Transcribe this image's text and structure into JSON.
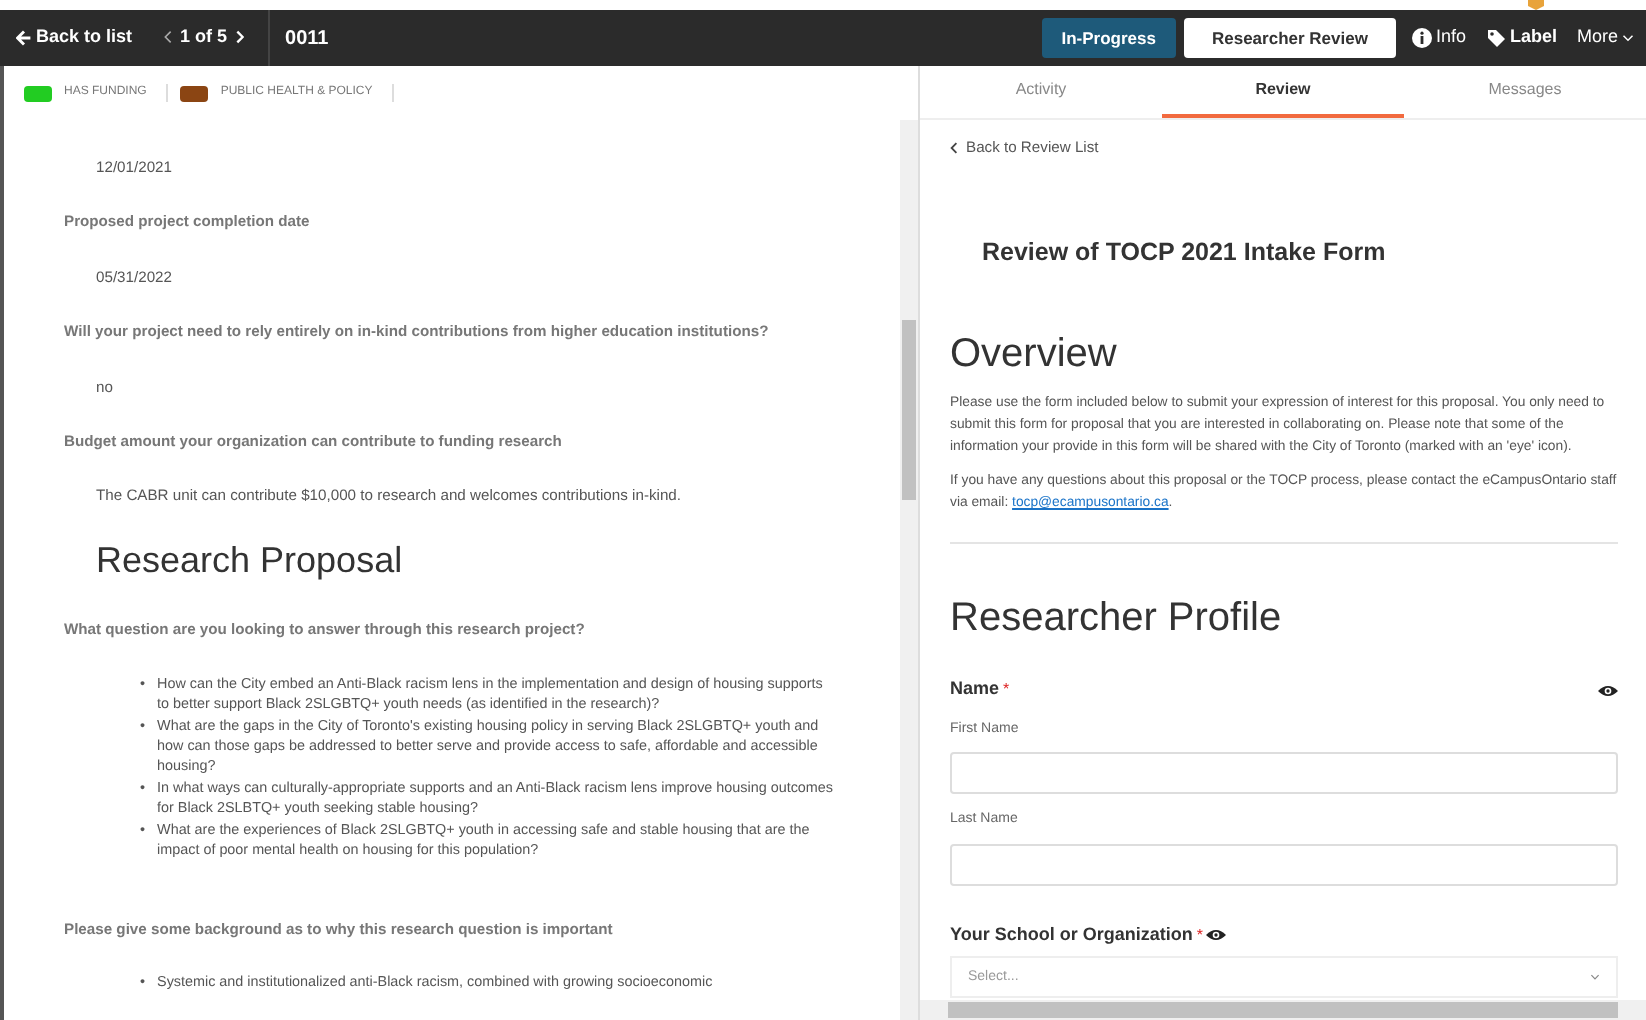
{
  "top_bar": {
    "back": "Back to list",
    "pager": "1 of 5",
    "record_id": "0011",
    "status": "In-Progress",
    "stage": "Researcher Review",
    "actions": [
      {
        "kind": "info",
        "label": "Info"
      },
      {
        "kind": "label",
        "label": "Label"
      },
      {
        "kind": "more",
        "label": "More"
      }
    ]
  },
  "tags": [
    {
      "label": "HAS FUNDING",
      "color": "#22cc22"
    },
    {
      "label": "PUBLIC HEALTH & POLICY",
      "color": "#8b4513"
    }
  ],
  "submission": [
    {
      "kind": "value",
      "text": "12/01/2021"
    },
    {
      "kind": "question",
      "text": "Proposed project completion date"
    },
    {
      "kind": "value",
      "text": "05/31/2022"
    },
    {
      "kind": "question",
      "text": "Will your project need to rely entirely on in-kind contributions from higher education institutions?"
    },
    {
      "kind": "value",
      "text": "no"
    },
    {
      "kind": "question",
      "text": "Budget amount your organization can contribute to funding research"
    },
    {
      "kind": "value",
      "text": "The CABR unit can contribute $10,000 to research and welcomes contributions in-kind."
    },
    {
      "kind": "heading",
      "text": "Research Proposal"
    },
    {
      "kind": "question",
      "text": "What question are you looking to answer through this research project?"
    },
    {
      "kind": "bullets",
      "items": [
        {
          "bullet": "•",
          "text": "How can the City embed an Anti-Black racism lens in the implementation and design of housing supports to better support Black 2SLGBTQ+ youth needs (as identified in the research)?"
        },
        {
          "bullet": "•",
          "text": "What are the gaps in the City of Toronto's existing housing policy in serving Black 2SLGBTQ+ youth and how can those gaps be addressed to better serve and provide access to safe, affordable and accessible housing?"
        },
        {
          "bullet": "•",
          "text": "In what ways can culturally-appropriate supports and an Anti-Black racism lens improve housing outcomes for Black 2SLBTQ+ youth seeking stable housing?"
        },
        {
          "bullet": "•",
          "text": "What are the experiences of Black 2SLGBTQ+ youth in accessing safe and stable housing that are the impact of poor mental health on housing for this population?"
        }
      ]
    },
    {
      "kind": "question",
      "text": "Please give some background as to why this research question is important"
    },
    {
      "kind": "bullets",
      "items": [
        {
          "bullet": "•",
          "text": "Systemic and institutionalized anti-Black racism, combined with growing socioeconomic"
        }
      ]
    }
  ],
  "tabs": [
    {
      "label": "Activity",
      "selected": false
    },
    {
      "label": "Review",
      "selected": true
    },
    {
      "label": "Messages",
      "selected": false
    }
  ],
  "review": {
    "back": "Back to Review List",
    "title": "Review of TOCP 2021 Intake Form",
    "overview_heading": "Overview",
    "paragraph_1": "Please use the form included below to submit your expression of interest for this proposal. You only need to submit this form for proposal that you are interested in collaborating on. Please note that some of the information your provide in this form will be shared with the City of Toronto (marked with an 'eye' icon).",
    "paragraph_2": "If you have any questions about this proposal or the TOCP process, please contact the eCampusOntario staff via email: ",
    "email": "tocp@ecampusontario.ca",
    "paragraph_2_end": ".",
    "profile_heading": "Researcher Profile",
    "questions": [
      {
        "kind": "name_group",
        "label": "Name",
        "required_mark": "*",
        "shared": true,
        "subfields": [
          {
            "label": "First Name",
            "kind": "text"
          },
          {
            "label": "Last Name",
            "kind": "text"
          }
        ]
      },
      {
        "kind": "dropdown",
        "label": "Your School or Organization",
        "required_mark": "*",
        "shared": true,
        "subfields": [
          {
            "kind": "select",
            "placeholder": "Select..."
          }
        ]
      }
    ]
  }
}
